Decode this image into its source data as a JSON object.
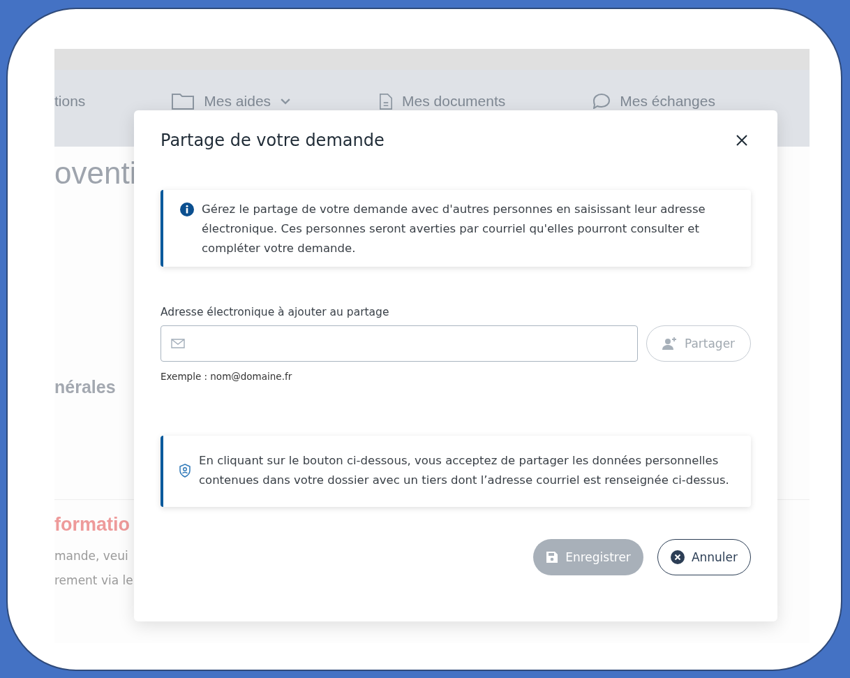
{
  "background_page": {
    "nav_items": [
      {
        "label": "tions",
        "selected": false
      },
      {
        "label": "Mes aides",
        "selected": false
      },
      {
        "label": "Mes documents",
        "selected": false
      },
      {
        "label": "Mes échanges",
        "selected": false
      }
    ],
    "heading": "oventi",
    "section_heading": "nérales",
    "alert_heading": "formatio",
    "alert_lines": [
      "mande, veui",
      "rement via le"
    ]
  },
  "dialog": {
    "title": "Partage de votre demande",
    "info_notice": {
      "text": "Gérez le partage de votre demande avec d'autres personnes en saisissant leur adresse électronique. Ces personnes seront averties par courriel qu'elles pourront consulter et compléter votre demande."
    },
    "email_field": {
      "label": "Adresse électronique à ajouter au partage",
      "hint": "Exemple : nom@domaine.fr"
    },
    "share_button": {
      "label": "Partager",
      "disabled": true
    },
    "consent_notice": {
      "text": "En cliquant sur le bouton ci-dessous, vous acceptez de partager les données personnelles contenues dans votre dossier avec un tiers dont l’adresse courriel est renseignée ci-dessus."
    },
    "buttons": [
      {
        "label": "Enregistrer",
        "kind": "primary",
        "disabled": true
      },
      {
        "label": "Annuler",
        "kind": "secondary",
        "disabled": false
      }
    ]
  }
}
